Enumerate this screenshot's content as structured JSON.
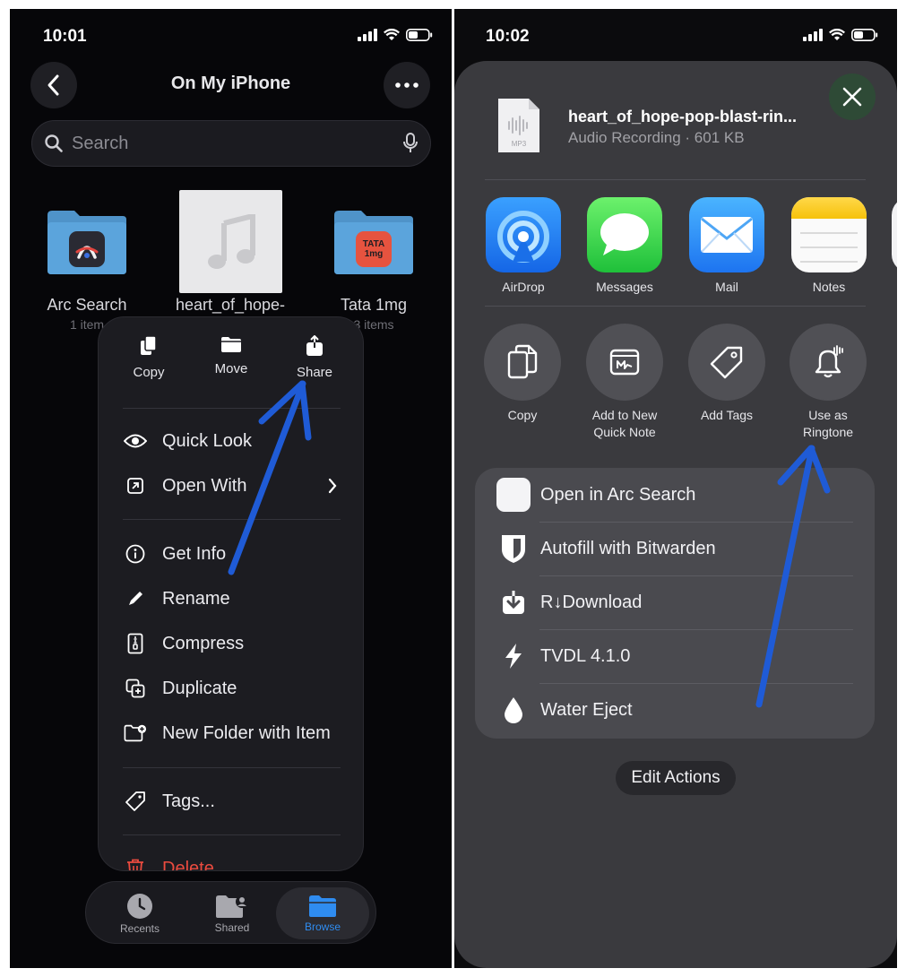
{
  "left": {
    "status_time": "10:01",
    "nav_title": "On My iPhone",
    "search_placeholder": "Search",
    "grid": [
      {
        "label": "Arc Search",
        "sub": "1 item"
      },
      {
        "label": "heart_of_hope-",
        "sub": ""
      },
      {
        "label": "Tata 1mg",
        "sub": "3 items"
      }
    ],
    "tata_logo_text": "TATA 1mg",
    "menu": {
      "top_actions": [
        "Copy",
        "Move",
        "Share"
      ],
      "items": [
        "Quick Look",
        "Open With",
        "Get Info",
        "Rename",
        "Compress",
        "Duplicate",
        "New Folder with Item",
        "Tags...",
        "Delete"
      ]
    },
    "tabs": [
      "Recents",
      "Shared",
      "Browse"
    ],
    "accent": "#2f8cf0",
    "delete_color": "#eb4b3f"
  },
  "right": {
    "status_time": "10:02",
    "file_name": "heart_of_hope-pop-blast-rin...",
    "file_meta": "Audio Recording · 601 KB",
    "file_type": "MP3",
    "apps": [
      "AirDrop",
      "Messages",
      "Mail",
      "Notes"
    ],
    "actions": [
      {
        "line1": "Copy",
        "line2": ""
      },
      {
        "line1": "Add to New",
        "line2": "Quick Note"
      },
      {
        "line1": "Add Tags",
        "line2": ""
      },
      {
        "line1": "Use as",
        "line2": "Ringtone"
      }
    ],
    "list": [
      "Open in Arc Search",
      "Autofill with Bitwarden",
      "R↓Download",
      "TVDL 4.1.0",
      "Water Eject"
    ],
    "edit_actions": "Edit Actions"
  },
  "annotation_color": "#1f5bd6"
}
